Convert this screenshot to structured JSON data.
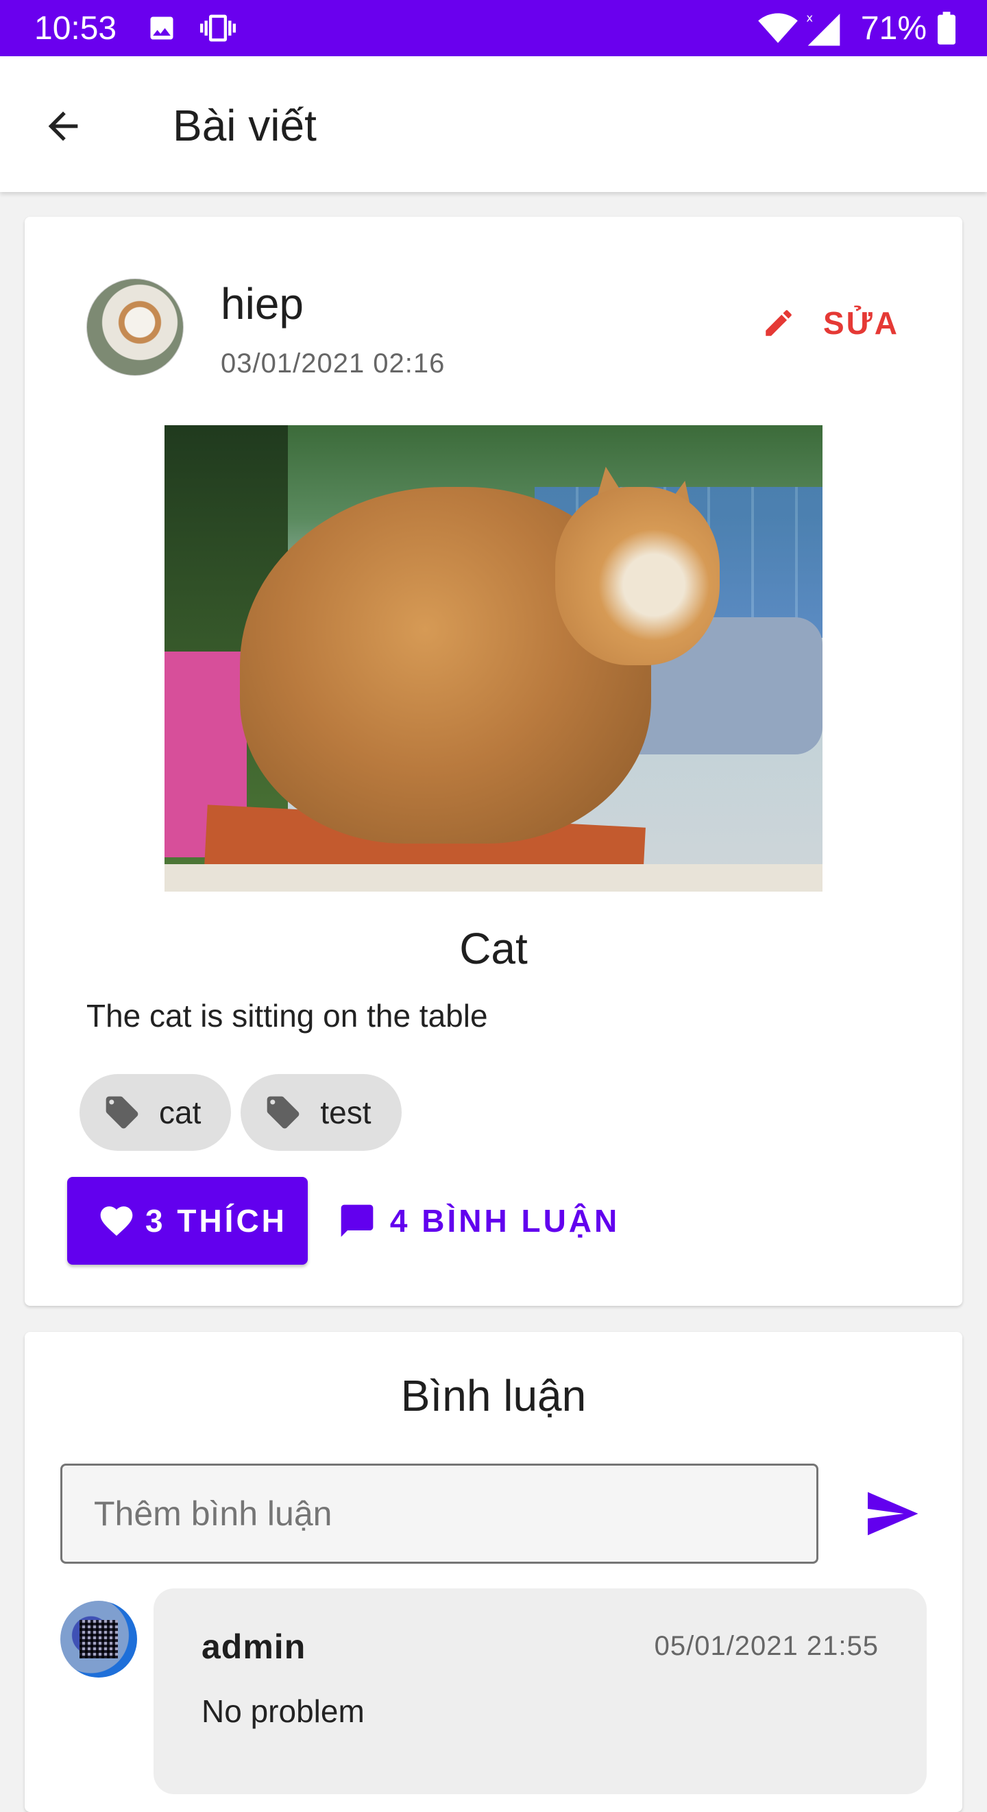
{
  "status_bar": {
    "time": "10:53",
    "battery": "71%",
    "icons": [
      "image-icon",
      "phone-vibrate-icon",
      "wifi-icon",
      "signal-icon",
      "battery-icon"
    ],
    "background": "#6a00ee"
  },
  "app_bar": {
    "title": "Bài viết",
    "back_icon": "arrow-back-icon"
  },
  "post": {
    "author": "hiep",
    "date": "03/01/2021 02:16",
    "edit_label": "SỬA",
    "title": "Cat",
    "description": "The cat is sitting on the table",
    "tags": [
      "cat",
      "test"
    ],
    "like_label": "3 THÍCH",
    "comment_label": "4 BÌNH LUẬN"
  },
  "comments": {
    "title": "Bình luận",
    "input_placeholder": "Thêm bình luận",
    "items": [
      {
        "author": "admin",
        "date": "05/01/2021 21:55",
        "text": "No problem"
      }
    ]
  },
  "colors": {
    "accent": "#6200ee",
    "edit": "#e53935",
    "chip": "#e0e0e0"
  }
}
